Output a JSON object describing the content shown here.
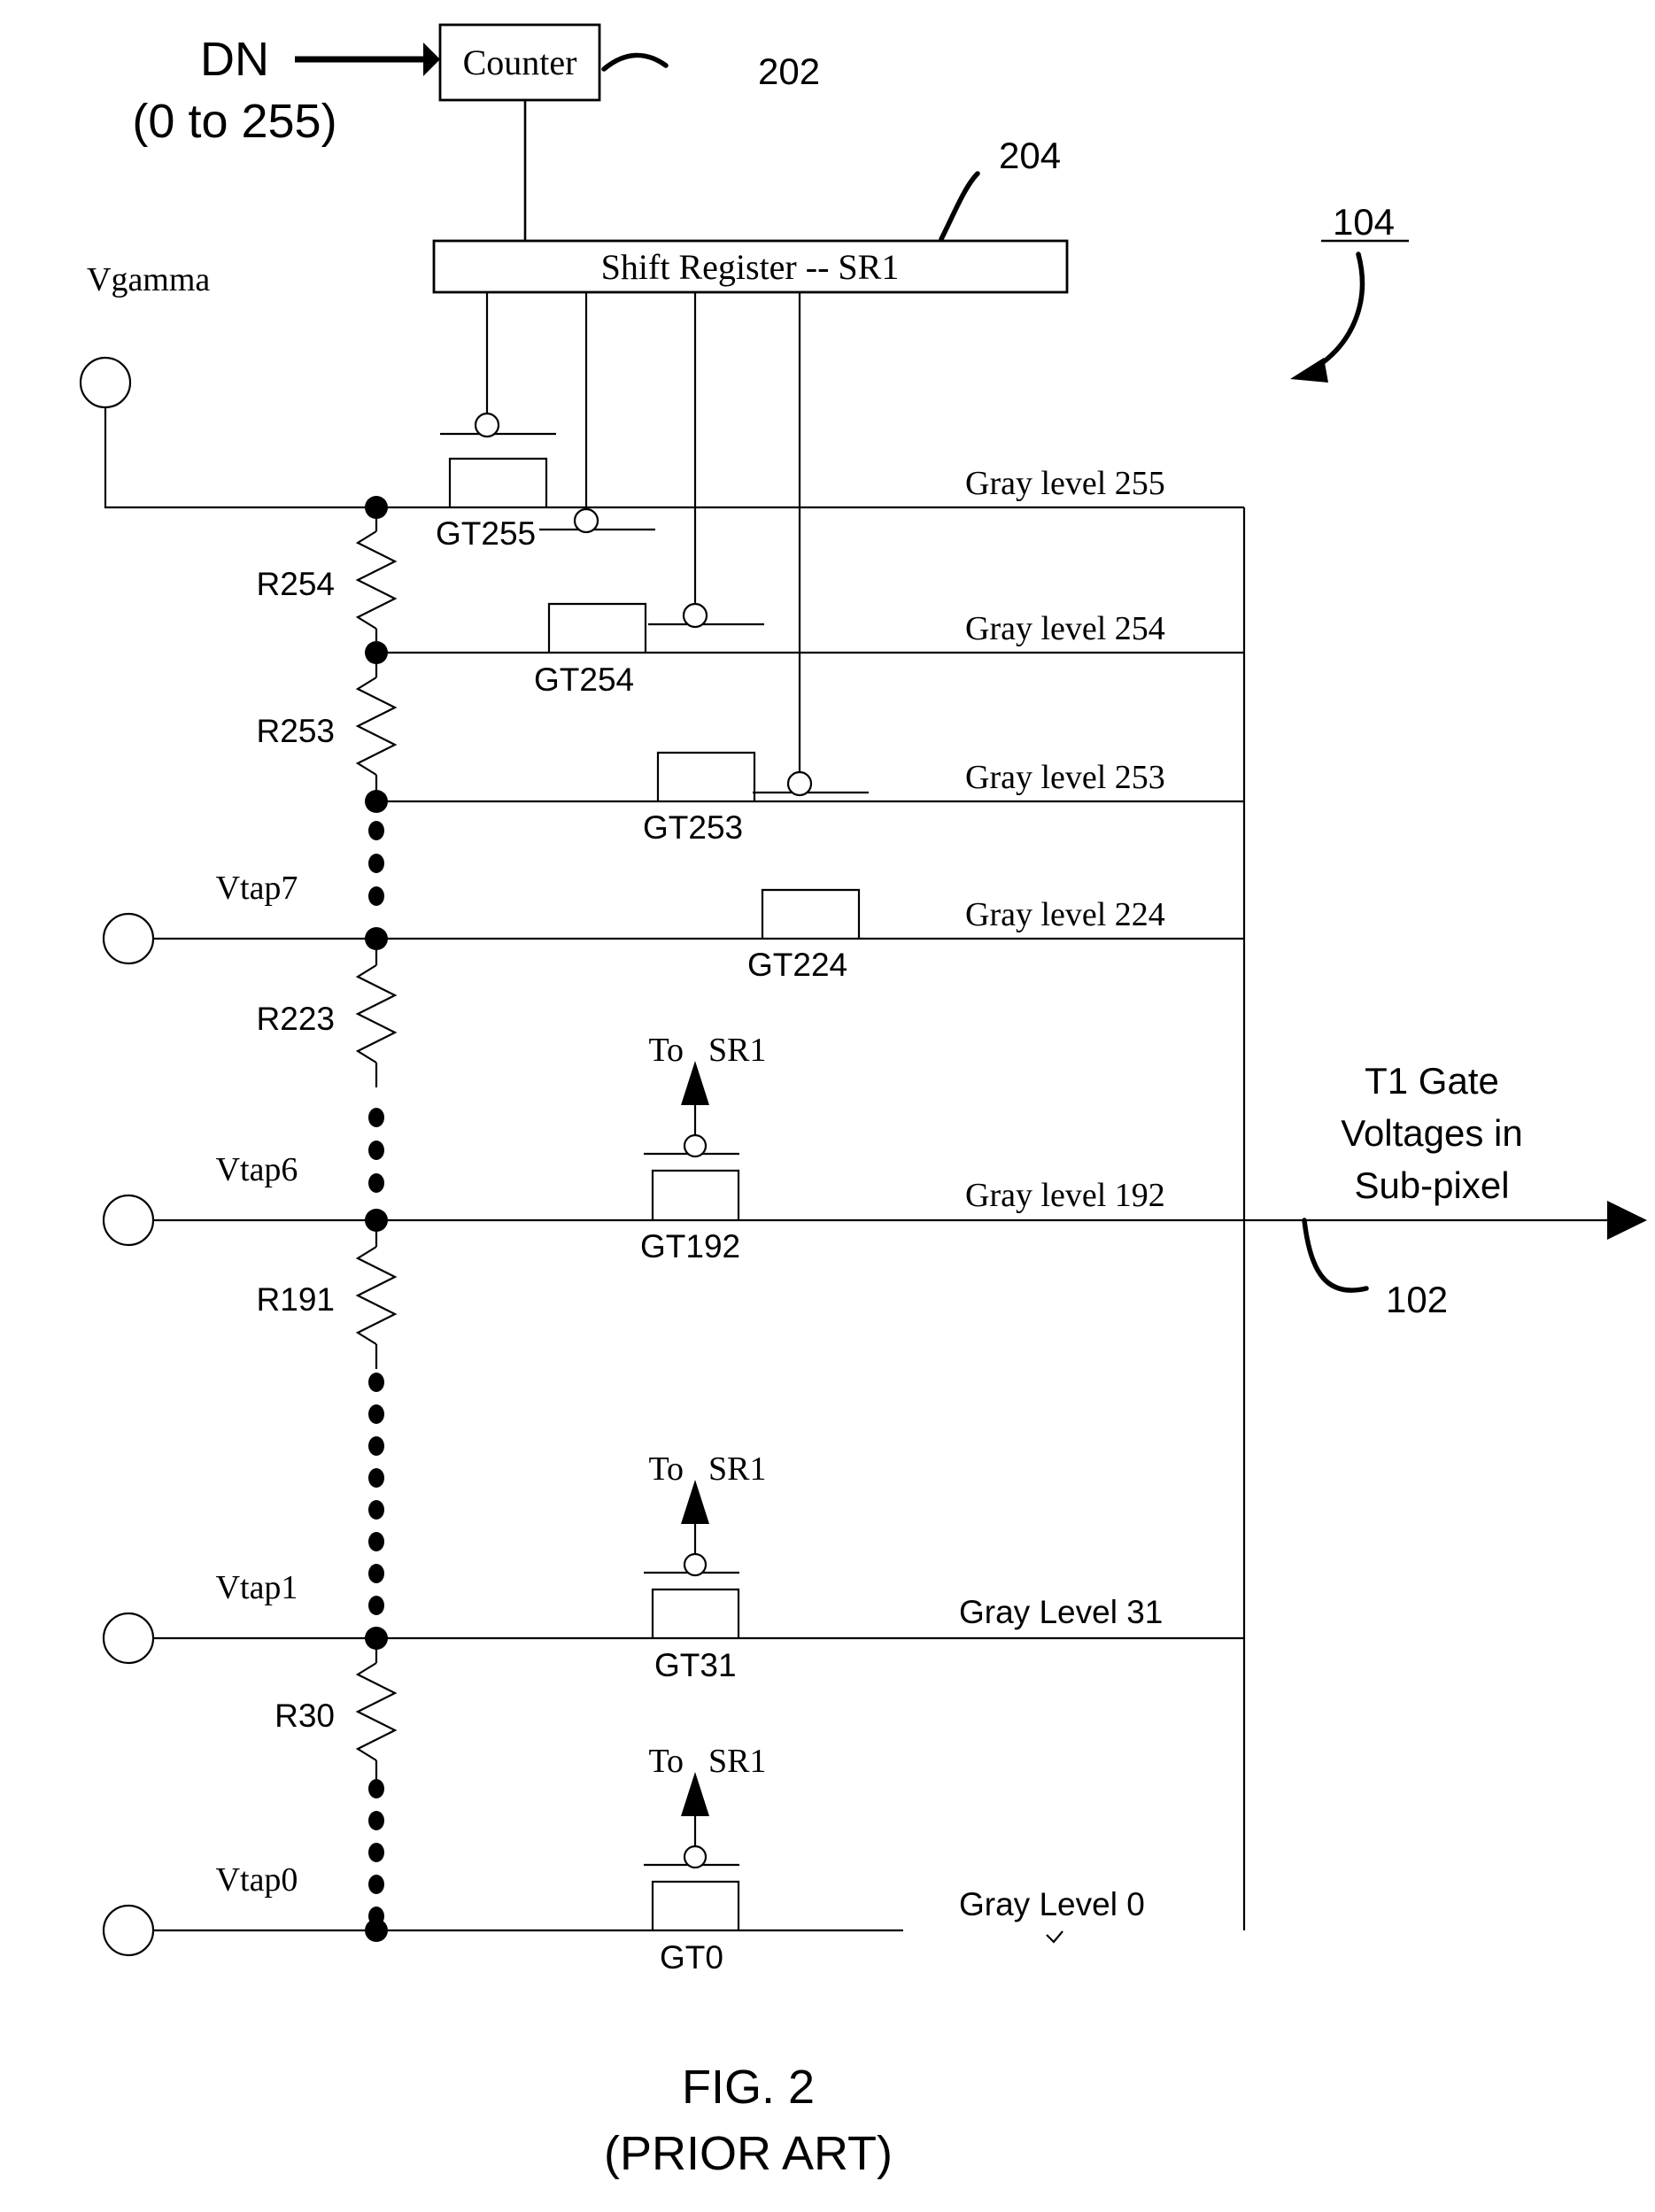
{
  "figure": {
    "caption_line1": "FIG. 2",
    "caption_line2": "(PRIOR ART)"
  },
  "blocks": {
    "counter": {
      "label": "Counter",
      "ref": "202"
    },
    "shift_register": {
      "label": "Shift Register -- SR1",
      "ref": "204"
    }
  },
  "inputs": {
    "dn_line1": "DN",
    "dn_line2": "(0 to 255)",
    "vgamma": "Vgamma"
  },
  "refs": {
    "dac_block": "104",
    "output_bus": "102"
  },
  "output_label": {
    "line1": "T1 Gate",
    "line2": "Voltages in",
    "line3": "Sub-pixel"
  },
  "taps": [
    {
      "name": "Vtap7"
    },
    {
      "name": "Vtap6"
    },
    {
      "name": "Vtap1"
    },
    {
      "name": "Vtap0"
    }
  ],
  "resistors": [
    {
      "name": "R254"
    },
    {
      "name": "R253"
    },
    {
      "name": "R223"
    },
    {
      "name": "R191"
    },
    {
      "name": "R30"
    }
  ],
  "switches": [
    {
      "name": "GT255",
      "gray": "Gray level 255",
      "to_sr1": null
    },
    {
      "name": "GT254",
      "gray": "Gray level 254",
      "to_sr1": null
    },
    {
      "name": "GT253",
      "gray": "Gray level 253",
      "to_sr1": null
    },
    {
      "name": "GT224",
      "gray": "Gray level 224",
      "to_sr1": null
    },
    {
      "name": "GT192",
      "gray": "Gray level 192",
      "to_sr1": "To SR1"
    },
    {
      "name": "GT31",
      "gray": "Gray Level 31",
      "to_sr1": "To SR1"
    },
    {
      "name": "GT0",
      "gray": "Gray Level 0",
      "to_sr1": "To SR1"
    }
  ],
  "to_sr1_label": {
    "prefix": "To",
    "suffix": "SR1"
  },
  "colors": {
    "ink": "#000000",
    "paper": "#ffffff"
  }
}
